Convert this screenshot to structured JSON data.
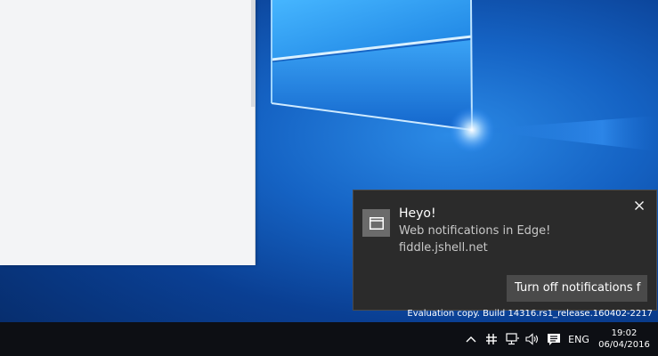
{
  "notification": {
    "title": "Heyo!",
    "body": "Web notifications in Edge!",
    "source": "fiddle.jshell.net",
    "action_label": "Turn off notifications f",
    "app_icon": "browser-window-icon",
    "close_icon": "close-icon"
  },
  "watermark": {
    "text": "Evaluation copy. Build 14316.rs1_release.160402-2217"
  },
  "taskbar": {
    "tray": {
      "chevron_icon": "chevron-up-icon",
      "settings_icon": "network-settings-icon",
      "network_icon": "network-icon",
      "volume_icon": "volume-icon",
      "action_center_icon": "action-center-icon",
      "language": "ENG",
      "time": "19:02",
      "date": "06/04/2016"
    }
  },
  "colors": {
    "toast_bg": "#2b2b2b",
    "toast_action_bg": "#4a4a4a",
    "taskbar_bg": "#0d0f14",
    "desktop_blue": "#1563c4"
  }
}
